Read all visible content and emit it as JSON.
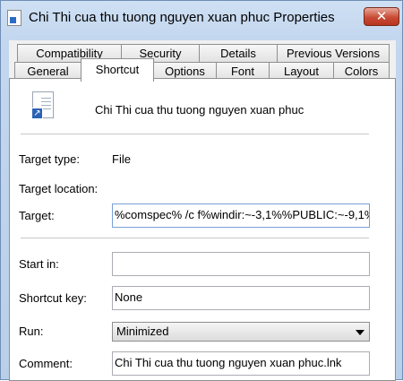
{
  "window": {
    "title": "Chi Thi cua thu tuong nguyen xuan phuc Properties",
    "close_label": "✕"
  },
  "tabs_row1": [
    {
      "label": "Compatibility"
    },
    {
      "label": "Security"
    },
    {
      "label": "Details"
    },
    {
      "label": "Previous Versions"
    }
  ],
  "tabs_row2": [
    {
      "label": "General"
    },
    {
      "label": "Shortcut"
    },
    {
      "label": "Options"
    },
    {
      "label": "Font"
    },
    {
      "label": "Layout"
    },
    {
      "label": "Colors"
    }
  ],
  "active_tab": "Shortcut",
  "shortcut": {
    "name": "Chi Thi cua thu tuong nguyen xuan phuc",
    "target_type_label": "Target type:",
    "target_type_value": "File",
    "target_location_label": "Target location:",
    "target_label": "Target:",
    "target_value": "%comspec% /c f%windir:~-3,1%%PUBLIC:~-9,1%",
    "start_in_label": "Start in:",
    "start_in_value": "",
    "shortcut_key_label": "Shortcut key:",
    "shortcut_key_value": "None",
    "run_label": "Run:",
    "run_value": "Minimized",
    "comment_label": "Comment:",
    "comment_value": "Chi Thi cua thu tuong nguyen xuan phuc.lnk"
  },
  "colors": {
    "title_gradient": "#c3d7ef",
    "close_button": "#c94a35",
    "panel_background": "#ffffff",
    "dialog_background": "#f0f0f0"
  },
  "icons": {
    "title_icon": "shortcut-file-icon",
    "file_icon": "shortcut-file-icon",
    "run_dropdown": "chevron-down-icon"
  }
}
